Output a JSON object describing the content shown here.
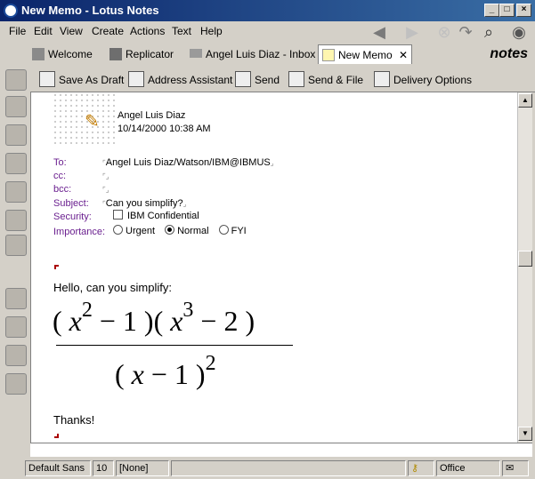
{
  "window": {
    "title": "New Memo - Lotus Notes"
  },
  "menu": [
    "File",
    "Edit",
    "View",
    "Create",
    "Actions",
    "Text",
    "Help"
  ],
  "tabs": [
    {
      "label": "Welcome"
    },
    {
      "label": "Replicator"
    },
    {
      "label": "Angel Luis Diaz - Inbox"
    },
    {
      "label": "New Memo"
    }
  ],
  "brand": "notes",
  "actions": [
    "Save As Draft",
    "Address Assistant",
    "Send",
    "Send & File",
    "Delivery Options"
  ],
  "memo": {
    "author": "Angel Luis Diaz",
    "date": "10/14/2000 10:38 AM",
    "labels": {
      "to": "To:",
      "cc": "cc:",
      "bcc": "bcc:",
      "subject": "Subject:",
      "security": "Security:",
      "importance": "Importance:"
    },
    "to": "Angel Luis Diaz/Watson/IBM@IBMUS",
    "cc": "",
    "bcc": "",
    "subject": "Can you simplify?",
    "security_option": "IBM Confidential",
    "importance_options": [
      "Urgent",
      "Normal",
      "FYI"
    ],
    "importance_selected": "Normal",
    "greeting": "Hello, can you simplify:",
    "closing": "Thanks!"
  },
  "equation": {
    "num_open1": "( ",
    "num_x1": "x",
    "num_exp1": "2",
    "num_rest1": " − 1 )( ",
    "num_x2": "x",
    "num_exp2": "3",
    "num_rest2": " − 2 )",
    "den_open": "( ",
    "den_x": "x",
    "den_rest": " − 1 )",
    "den_exp": "2"
  },
  "status": {
    "font": "Default Sans",
    "size": "10",
    "style": "[None]",
    "location": "Office"
  }
}
